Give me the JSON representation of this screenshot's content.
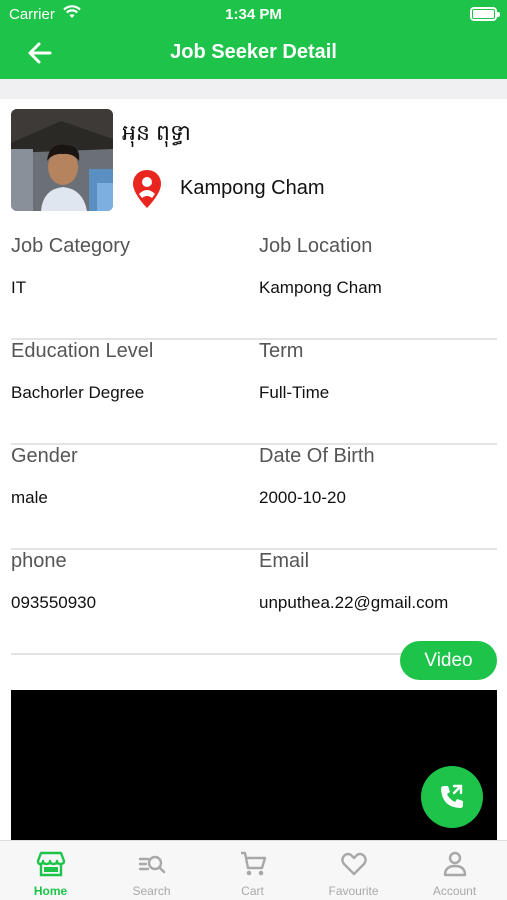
{
  "status_bar": {
    "carrier": "Carrier",
    "time": "1:34 PM"
  },
  "nav": {
    "title": "Job Seeker Detail"
  },
  "profile": {
    "name": "អុន ពុទ្ធា",
    "location": "Kampong Cham"
  },
  "details": [
    {
      "left_label": "Job Category",
      "left_value": "IT",
      "right_label": "Job Location",
      "right_value": "Kampong Cham"
    },
    {
      "left_label": "Education Level",
      "left_value": "Bachorler Degree",
      "right_label": "Term",
      "right_value": "Full-Time"
    },
    {
      "left_label": "Gender",
      "left_value": "male",
      "right_label": "Date Of Birth",
      "right_value": "2000-10-20"
    },
    {
      "left_label": "phone",
      "left_value": "093550930",
      "right_label": "Email",
      "right_value": "unputhea.22@gmail.com"
    }
  ],
  "video": {
    "button_label": "Video"
  },
  "tabs": [
    {
      "label": "Home",
      "icon": "store-icon",
      "active": true
    },
    {
      "label": "Search",
      "icon": "search-icon",
      "active": false
    },
    {
      "label": "Cart",
      "icon": "cart-icon",
      "active": false
    },
    {
      "label": "Favourite",
      "icon": "heart-icon",
      "active": false
    },
    {
      "label": "Account",
      "icon": "person-icon",
      "active": false
    }
  ],
  "colors": {
    "brand": "#1ec34a",
    "pin": "#e8261f",
    "inactive": "#a8a8a8"
  }
}
